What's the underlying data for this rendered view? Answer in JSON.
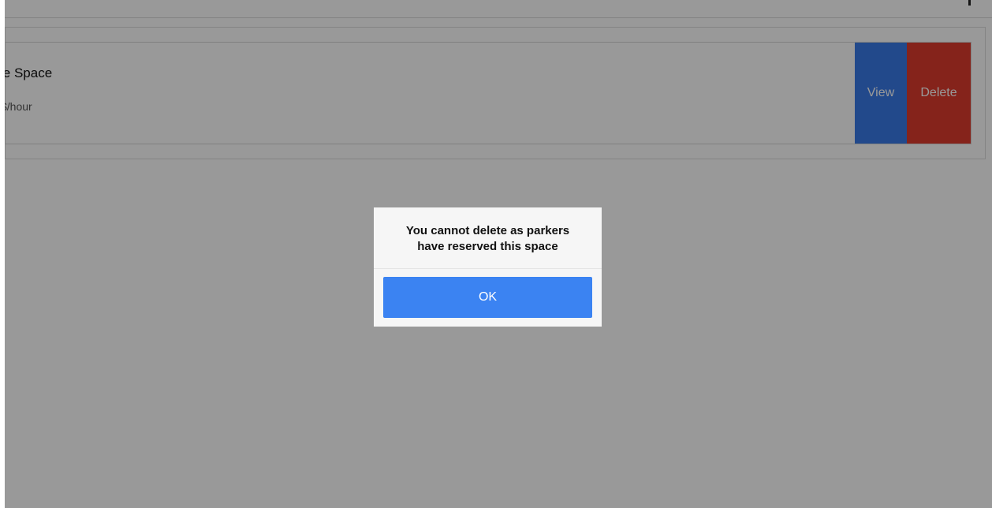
{
  "listing": {
    "name": "le Space",
    "rate": "$/hour",
    "view_label": "View",
    "delete_label": "Delete"
  },
  "dialog": {
    "message_line1": "You cannot delete as parkers",
    "message_line2": "have reserved this space",
    "ok_label": "OK"
  },
  "colors": {
    "view_button": "#3a7ae8",
    "delete_button": "#de3b2e",
    "ok_button": "#3b83f2",
    "overlay": "rgba(0,0,0,0.4)"
  }
}
